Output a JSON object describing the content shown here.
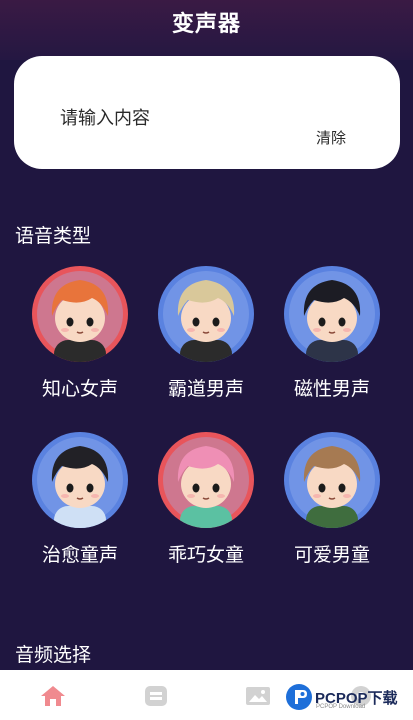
{
  "header": {
    "title": "变声器"
  },
  "input": {
    "placeholder": "请输入内容",
    "clear_label": "清除"
  },
  "sections": {
    "voice_type": "语音类型",
    "audio_select": "音频选择"
  },
  "voices": [
    {
      "label": "知心女声",
      "ring": "#e8555b",
      "hair": "#e8743b",
      "skin": "#f8d9c4",
      "shirt": "#2b2b2b"
    },
    {
      "label": "霸道男声",
      "ring": "#5a82e0",
      "hair": "#d9c89a",
      "skin": "#f8d9c4",
      "shirt": "#2b2b2b"
    },
    {
      "label": "磁性男声",
      "ring": "#5a82e0",
      "hair": "#1c1c24",
      "skin": "#f8d9c4",
      "shirt": "#2d3448"
    },
    {
      "label": "治愈童声",
      "ring": "#5a82e0",
      "hair": "#222126",
      "skin": "#f8d9c4",
      "shirt": "#cfe0f5"
    },
    {
      "label": "乖巧女童",
      "ring": "#e8555b",
      "hair": "#ef8fb5",
      "skin": "#f8d9c4",
      "shirt": "#5bc1a2"
    },
    {
      "label": "可爱男童",
      "ring": "#5a82e0",
      "hair": "#a67a52",
      "skin": "#f8d9c4",
      "shirt": "#3f6d3e"
    }
  ],
  "bottom_nav": {
    "tabs": [
      {
        "icon": "home-icon",
        "color": "#f08a8f"
      },
      {
        "icon": "card-icon",
        "color": "#cfcfcf"
      },
      {
        "icon": "image-icon",
        "color": "#cfcfcf"
      }
    ]
  },
  "watermark": {
    "brand": "PCPOP下载",
    "sub": "PCPOP Download"
  }
}
